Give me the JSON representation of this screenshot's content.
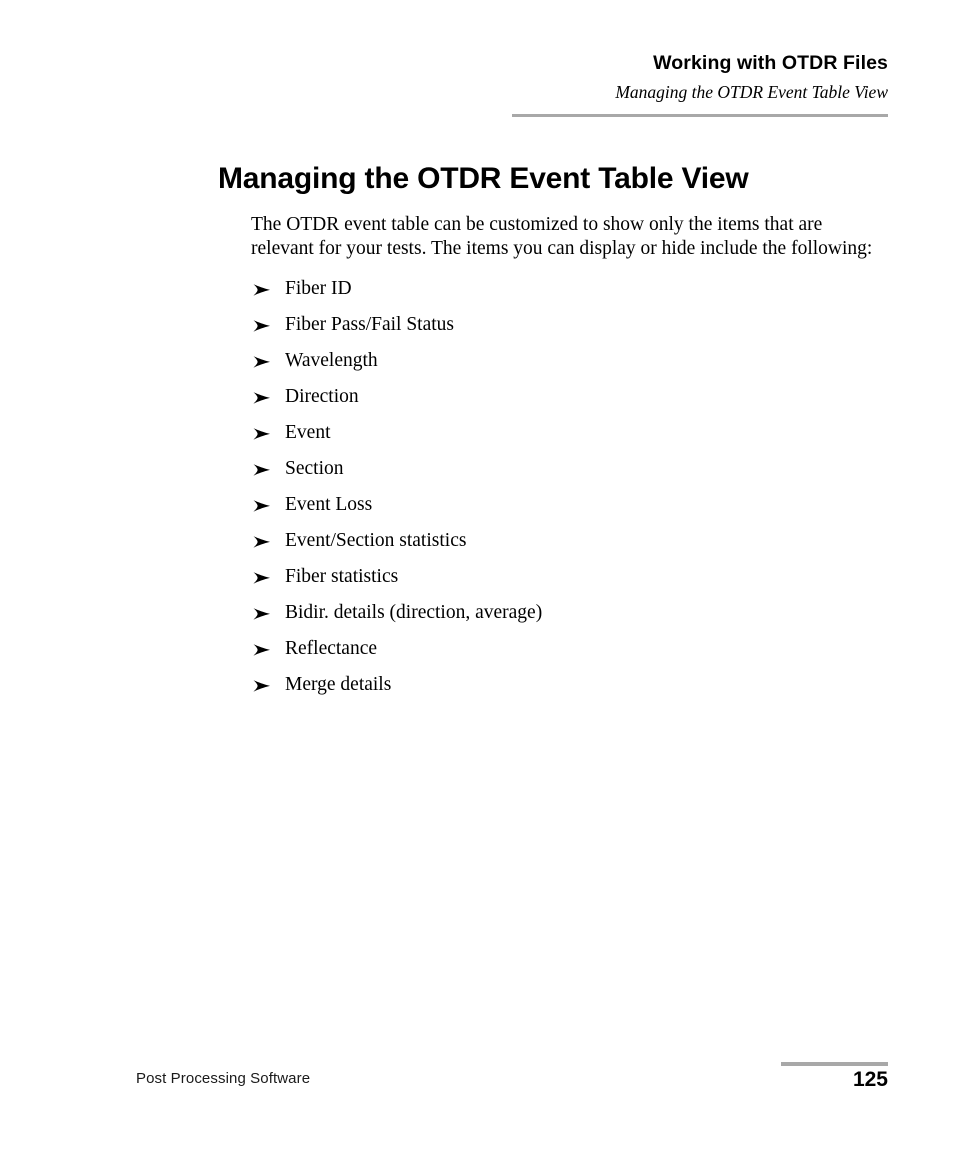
{
  "header": {
    "chapter_title": "Working with OTDR Files",
    "section_title": "Managing the OTDR Event Table View",
    "rule_color": "#a8a8a8"
  },
  "main": {
    "heading": "Managing the OTDR Event Table View",
    "intro_paragraph": "The OTDR event table can be customized to show only the items that are relevant for your tests. The items you can display or hide include the following:",
    "bullet_icon": "arrowhead-right-icon",
    "items": [
      {
        "label": "Fiber ID"
      },
      {
        "label": "Fiber Pass/Fail Status"
      },
      {
        "label": "Wavelength"
      },
      {
        "label": "Direction"
      },
      {
        "label": "Event"
      },
      {
        "label": "Section"
      },
      {
        "label": "Event Loss"
      },
      {
        "label": "Event/Section statistics"
      },
      {
        "label": "Fiber statistics"
      },
      {
        "label": "Bidir. details (direction, average)"
      },
      {
        "label": "Reflectance"
      },
      {
        "label": "Merge details"
      }
    ]
  },
  "footer": {
    "product_name": "Post Processing Software",
    "page_number": "125",
    "rule_color": "#a8a8a8"
  }
}
